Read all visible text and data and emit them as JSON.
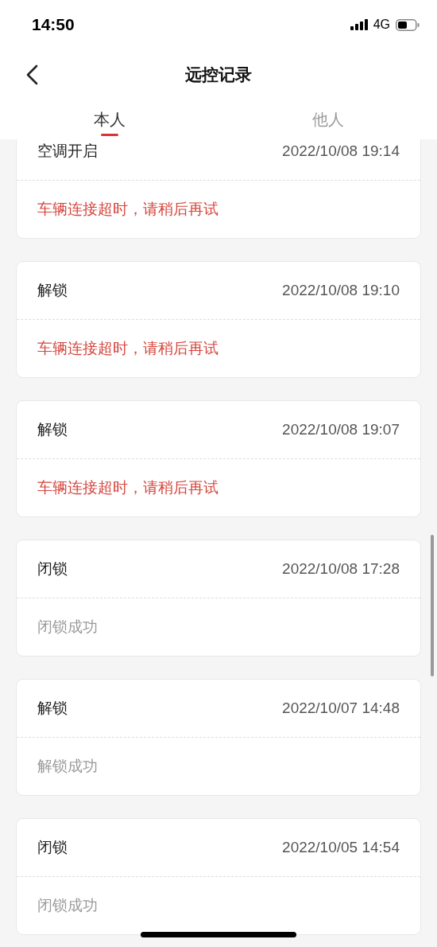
{
  "status_bar": {
    "time": "14:50",
    "network": "4G"
  },
  "nav": {
    "title": "远控记录"
  },
  "tabs": [
    {
      "label": "本人",
      "selected": true
    },
    {
      "label": "他人",
      "selected": false
    }
  ],
  "records": [
    {
      "action": "空调开启",
      "time": "2022/10/08 19:14",
      "result": "车辆连接超时，请稍后再试",
      "kind": "failed"
    },
    {
      "action": "解锁",
      "time": "2022/10/08 19:10",
      "result": "车辆连接超时，请稍后再试",
      "kind": "failed"
    },
    {
      "action": "解锁",
      "time": "2022/10/08 19:07",
      "result": "车辆连接超时，请稍后再试",
      "kind": "failed"
    },
    {
      "action": "闭锁",
      "time": "2022/10/08 17:28",
      "result": "闭锁成功",
      "kind": "success"
    },
    {
      "action": "解锁",
      "time": "2022/10/07 14:48",
      "result": "解锁成功",
      "kind": "success"
    },
    {
      "action": "闭锁",
      "time": "2022/10/05 14:54",
      "result": "闭锁成功",
      "kind": "success"
    }
  ]
}
